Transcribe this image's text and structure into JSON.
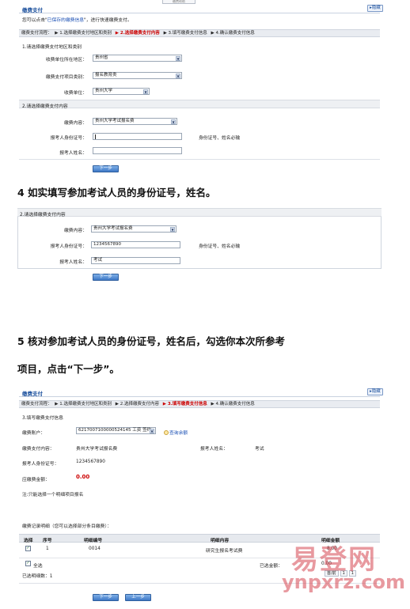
{
  "top": {
    "tab_stub": "缴费帮助",
    "title": "缴费支付",
    "hide": "隐藏",
    "notice_prefix": "您可以点击\"",
    "notice_link": "已保存的缴费信息",
    "notice_suffix": "\"，进行快速缴费支付。",
    "steps_label": "缴费支付流程：",
    "steps": [
      "▶ 1.选择缴费支付地区和类别",
      "▶ 2.选择缴费支付内容",
      "▶ 3.填写缴费支付信息",
      "▶ 4.确认缴费支付信息"
    ],
    "current_step": 1,
    "section1_title": "1.请选择缴费支付地区和类别",
    "region_label": "收费单位所在地区：",
    "region_value": "贵州省",
    "category_label": "缴费支付项目类别：",
    "category_value": "报名教育类",
    "unit_label": "收费单位：",
    "unit_value": "贵州大学",
    "section2_title": "2.请选择缴费支付内容",
    "content_label": "缴费内容：",
    "content_value": "贵州大学考试报名费",
    "id_label": "报考人身份证号：",
    "id_value": "",
    "id_hint": "身份证号、姓名必输",
    "name_label": "报考人姓名：",
    "name_value": "",
    "next_button": "下一步"
  },
  "step4": {
    "heading": "4 如实填写参加考试人员的身份证号，姓名。",
    "section2_title": "2.请选择缴费支付内容",
    "content_label": "缴费内容：",
    "content_value": "贵州大学考试报名费",
    "id_label": "报考人身份证号：",
    "id_value": "1234567890",
    "id_hint": "身份证号、姓名必输",
    "name_label": "报考人姓名：",
    "name_value": "考试",
    "next_button": "下一步"
  },
  "step5": {
    "heading_line1": "5  核对参加考试人员的身份证号，姓名后，勾选你本次所参考",
    "heading_line2": "项目，点击“下一步”。"
  },
  "bottom": {
    "title": "缴费支付",
    "hide": "隐藏",
    "steps_label": "缴费支付流程：",
    "steps": [
      "▶ 1.选择缴费支付地区和类别",
      "▶ 2.选择缴费支付内容",
      "▶ 3.填写缴费支付信息",
      "▶ 4.确认缴费支付信息"
    ],
    "current_step": 2,
    "section3_title": "3.填写缴费支付信息",
    "account_label": "缴费账户：",
    "account_value": "6217007100000524145 工资 签约",
    "query_balance": "查询余额",
    "content_label": "缴费支付内容：",
    "content_value": "贵州大学考试报名费",
    "name_label": "报考人姓名：",
    "name_value": "考试",
    "id_label": "报考人身份证号：",
    "id_value": "1234567890",
    "amount_label": "应缴费金额：",
    "amount_value": "0.00",
    "note": "注:只能选择一个明细项目报名",
    "detail_title": "缴费记录明细（您可以选择部分条目缴费）：",
    "table_headers": [
      "选择",
      "序号",
      "明细编号",
      "明细内容",
      "明细金额"
    ],
    "rows": [
      {
        "checked": true,
        "seq": "1",
        "code": "0014",
        "content": "研究生报名考试费",
        "amount": "8.00"
      }
    ],
    "select_all": "全选",
    "selected_amount_label": "已选金额：",
    "selected_amount_value": "0.00",
    "selected_count_label": "已选明细数：1",
    "pager_prev": "首/前",
    "pager_page": "1",
    "pager_next": "1",
    "next_button": "下一步",
    "prev_button": "上一步"
  },
  "watermark": {
    "cn": "易登网",
    "en": "ynpxrz.com"
  }
}
